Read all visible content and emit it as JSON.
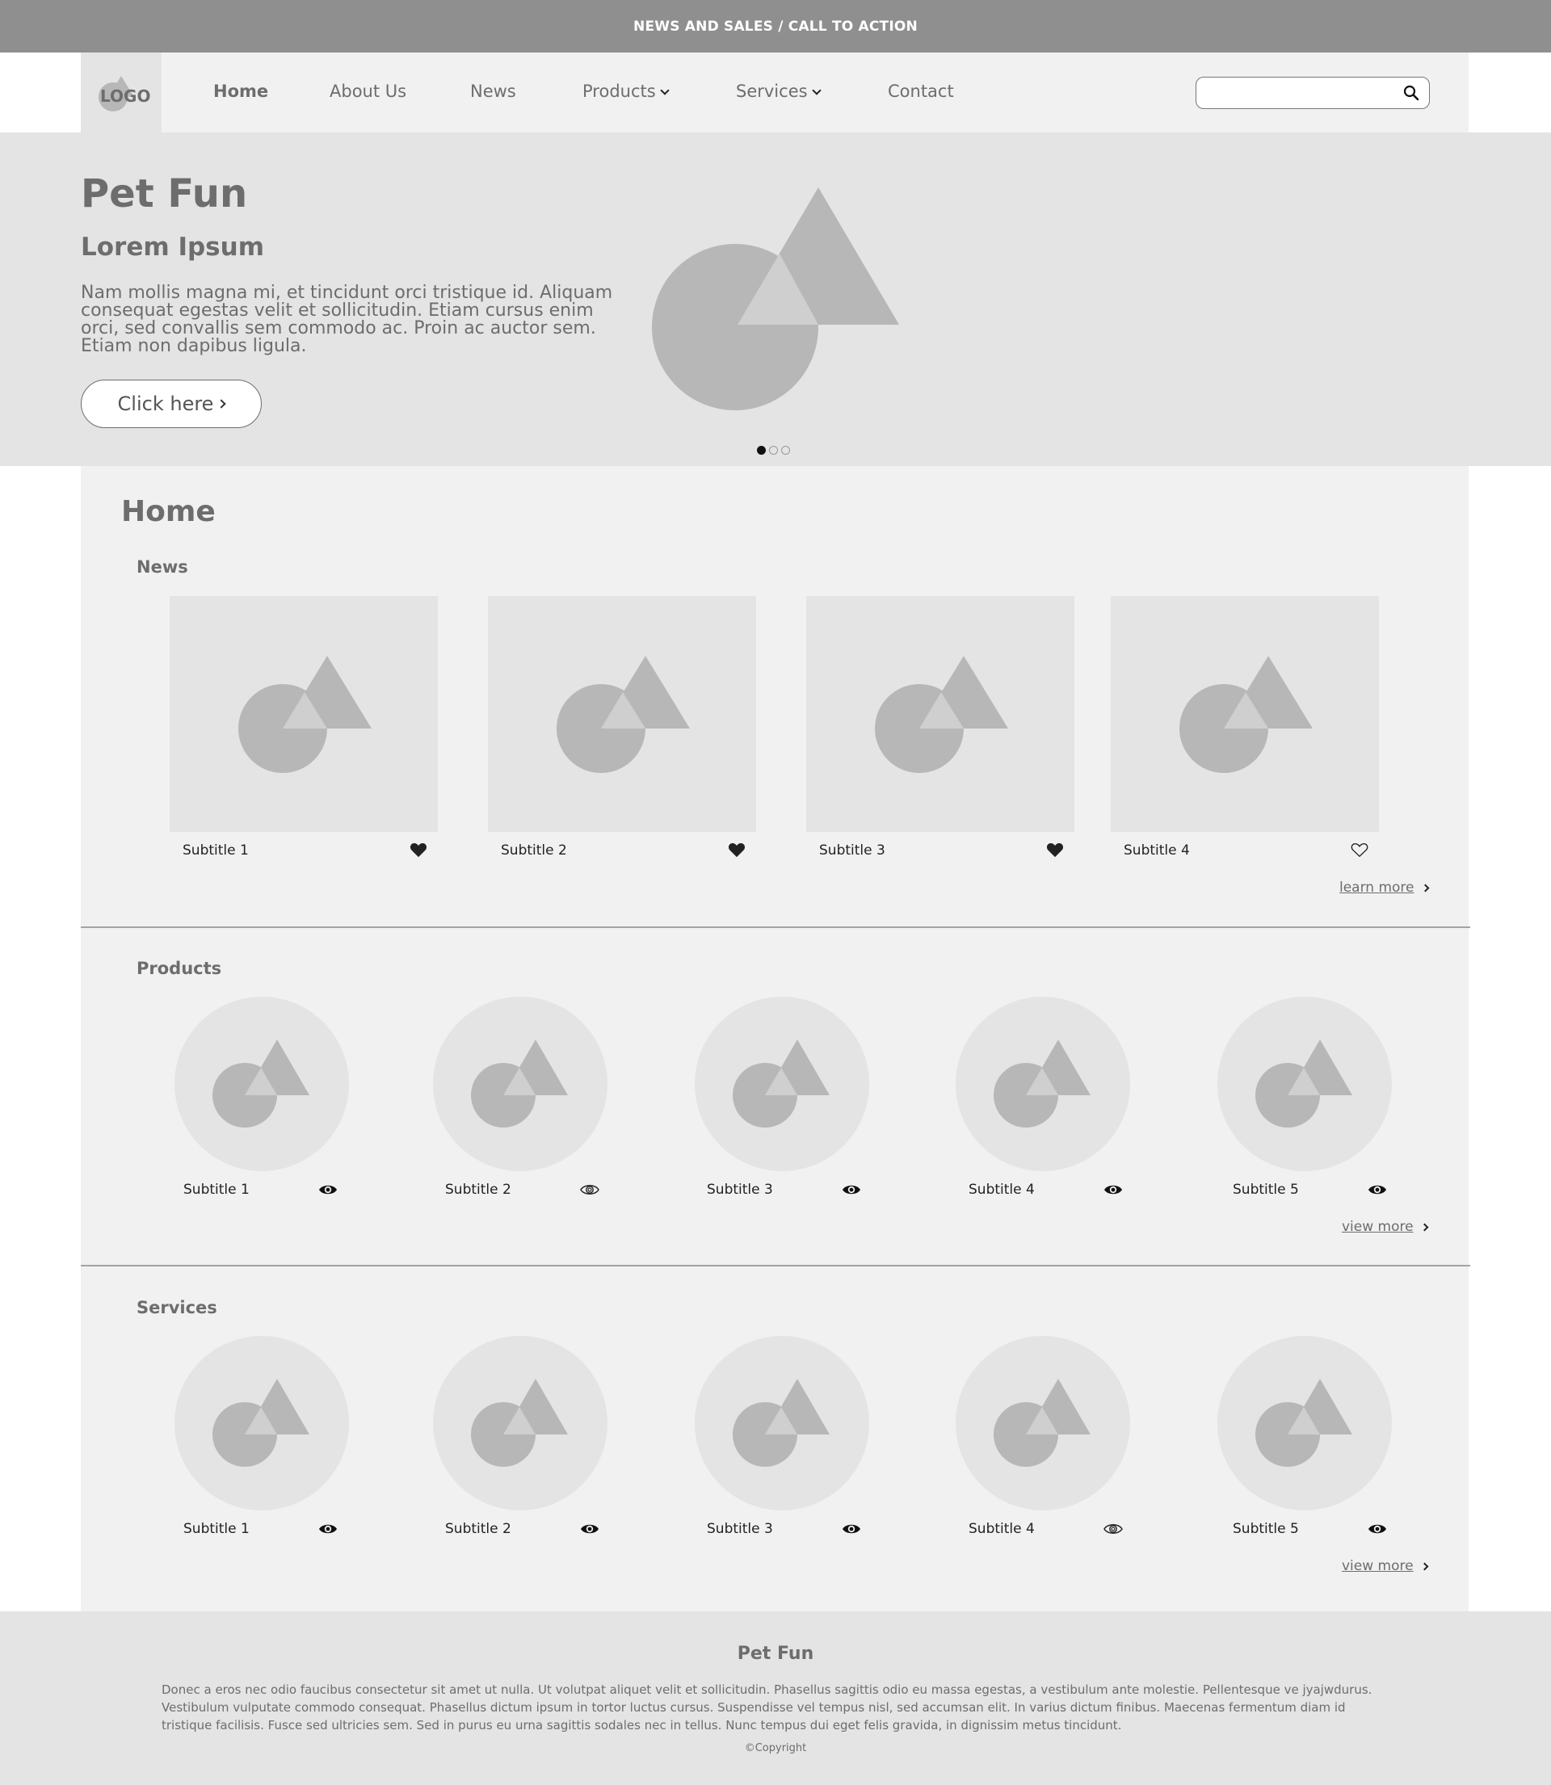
{
  "topbar": {
    "text": "NEWS AND SALES / CALL TO ACTION"
  },
  "nav": {
    "logo": "LOGO",
    "links": [
      {
        "label": "Home"
      },
      {
        "label": "About Us"
      },
      {
        "label": "News"
      },
      {
        "label": "Products"
      },
      {
        "label": "Services"
      },
      {
        "label": "Contact"
      }
    ],
    "search_value": ""
  },
  "hero": {
    "title": "Pet Fun",
    "subtitle": "Lorem Ipsum",
    "text": "Nam mollis magna mi, et tincidunt orci tristique id. Aliquam consequat egestas velit et sollicitudin. Etiam cursus enim orci, sed convallis sem commodo ac. Proin ac auctor sem. Etiam non dapibus ligula.",
    "button": "Click here",
    "slides_total": 3,
    "active_slide": 1
  },
  "main": {
    "title": "Home",
    "news": {
      "title": "News",
      "items": [
        {
          "subtitle": "Subtitle 1",
          "icon": "heart-filled-icon"
        },
        {
          "subtitle": "Subtitle 2",
          "icon": "heart-filled-icon"
        },
        {
          "subtitle": "Subtitle 3",
          "icon": "heart-filled-icon"
        },
        {
          "subtitle": "Subtitle 4",
          "icon": "heart-outline-icon"
        }
      ],
      "more": "learn more"
    },
    "products": {
      "title": "Products",
      "items": [
        {
          "subtitle": "Subtitle 1",
          "icon": "eye-icon"
        },
        {
          "subtitle": "Subtitle 2",
          "icon": "eye-outline-icon"
        },
        {
          "subtitle": "Subtitle 3",
          "icon": "eye-icon"
        },
        {
          "subtitle": "Subtitle 4",
          "icon": "eye-icon"
        },
        {
          "subtitle": "Subtitle 5",
          "icon": "eye-icon"
        }
      ],
      "more": "view more"
    },
    "services": {
      "title": "Services",
      "items": [
        {
          "subtitle": "Subtitle 1",
          "icon": "eye-icon"
        },
        {
          "subtitle": "Subtitle 2",
          "icon": "eye-icon"
        },
        {
          "subtitle": "Subtitle 3",
          "icon": "eye-icon"
        },
        {
          "subtitle": "Subtitle 4",
          "icon": "eye-outline-icon"
        },
        {
          "subtitle": "Subtitle 5",
          "icon": "eye-icon"
        }
      ],
      "more": "view more"
    }
  },
  "footer": {
    "title": "Pet Fun",
    "text": "Donec a eros nec odio faucibus consectetur sit amet ut nulla. Ut volutpat aliquet velit et sollicitudin. Phasellus sagittis odio eu massa egestas, a vestibulum ante molestie. Pellentesque ve jyajwdurus. Vestibulum vulputate commodo consequat. Phasellus dictum ipsum in tortor luctus cursus. Suspendisse vel tempus nisl, sed accumsan elit. In varius dictum finibus. Maecenas fermentum diam id tristique facilisis. Fusce sed ultricies sem. Sed in purus eu urna sagittis sodales nec in tellus. Nunc tempus dui eget felis gravida, in dignissim metus tincidunt.",
    "copyright": "©Copyright"
  },
  "colors": {
    "topbar": "#8f8f8f",
    "panel": "#f1f1f1",
    "placeholder": "#e4e4e4",
    "shape": "#b7b7b7",
    "text": "#6d6d6d"
  }
}
